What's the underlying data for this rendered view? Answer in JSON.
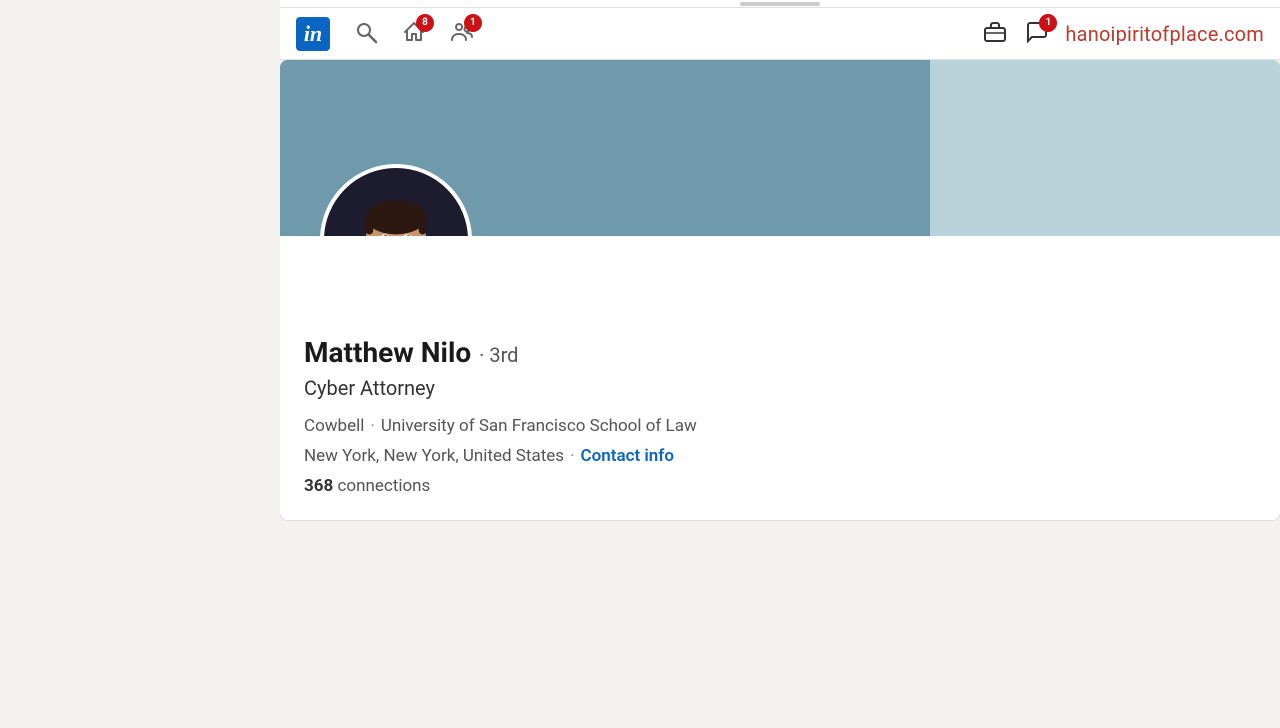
{
  "site": {
    "logo_letter": "in",
    "external_domain": "hanoipiritofplace.com"
  },
  "navbar": {
    "search_placeholder": "Search",
    "home_badge": "8",
    "network_badge": "1",
    "messaging_badge": "1"
  },
  "profile": {
    "name": "Matthew Nilo",
    "degree": "· 3rd",
    "title": "Cyber Attorney",
    "company": "Cowbell",
    "school": "University of San Francisco School of Law",
    "location": "New York, New York, United States",
    "contact_info_label": "Contact info",
    "connections_count": "368",
    "connections_label": "connections"
  },
  "scroll_bar": {
    "visible": true
  }
}
